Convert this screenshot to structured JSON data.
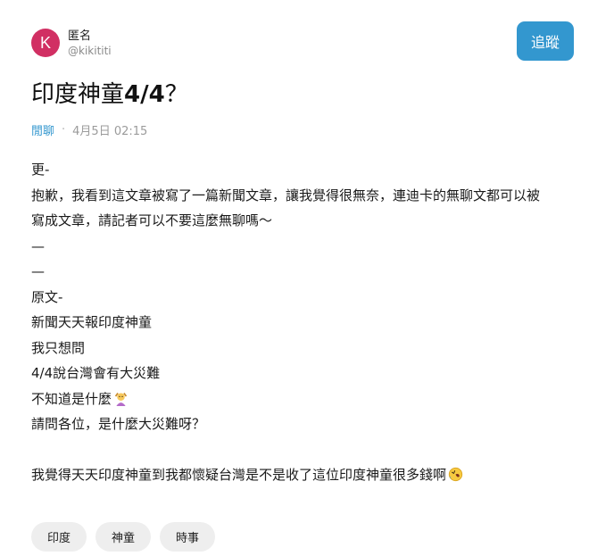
{
  "author": {
    "avatar_letter": "K",
    "avatar_color": "#d12f63",
    "name": "匿名",
    "handle": "@kikititi"
  },
  "follow_button": {
    "label": "追蹤",
    "color": "#3397cf"
  },
  "post": {
    "title_prefix": "印度神童",
    "title_bold": "4/4",
    "title_suffix": "？",
    "category": "閒聊",
    "separator": "·",
    "timestamp": "4月5日 02:15",
    "lines": [
      "更-",
      "抱歉，我看到這文章被寫了一篇新聞文章，讓我覺得很無奈，連迪卡的無聊文都可以被",
      "寫成文章，請記者可以不要這麼無聊嗎～",
      "—",
      "—",
      "原文-",
      "新聞天天報印度神童",
      "我只想問",
      "4/4說台灣會有大災難",
      "不知道是什麼",
      "請問各位，是什麼大災難呀？",
      "",
      "我覺得天天印度神童到我都懷疑台灣是不是收了這位印度神童很多錢啊"
    ],
    "line_emojis": {
      "9": "person-shrugging-emoji-icon",
      "12": "rolling-on-floor-laughing-emoji-icon"
    }
  },
  "tags": [
    "印度",
    "神童",
    "時事"
  ]
}
